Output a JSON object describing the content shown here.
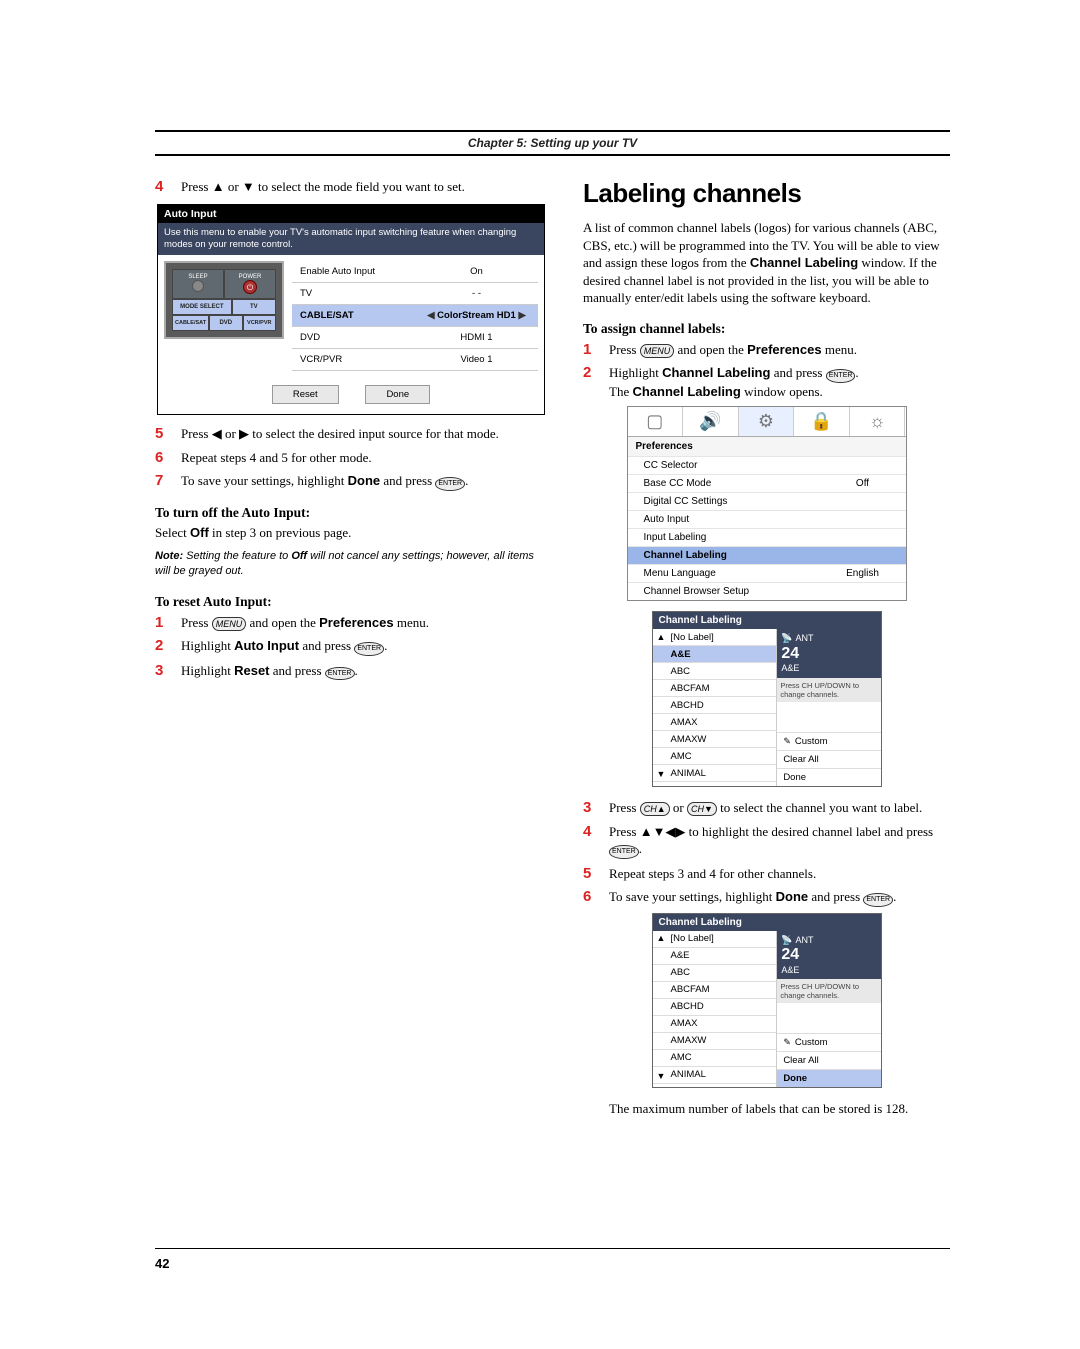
{
  "chapter_header": "Chapter 5: Setting up your TV",
  "page_number": "42",
  "left": {
    "step4": "Press ▲ or ▼ to select the mode field you want to set.",
    "auto_input": {
      "title": "Auto Input",
      "desc": "Use this menu to enable your TV's automatic input switching feature when changing modes on your remote control.",
      "remote": {
        "sleep": "SLEEP",
        "power": "POWER",
        "mode_select": "MODE SELECT",
        "tv": "TV",
        "cablesat": "CABLE/SAT",
        "dvd": "DVD",
        "vcrpvr": "VCR/PVR"
      },
      "table_header_left": "Enable Auto Input",
      "table_header_right": "On",
      "rows": [
        {
          "mode": "TV",
          "input": "- -"
        },
        {
          "mode": "CABLE/SAT",
          "input": "ColorStream HD1"
        },
        {
          "mode": "DVD",
          "input": "HDMI 1"
        },
        {
          "mode": "VCR/PVR",
          "input": "Video 1"
        }
      ],
      "reset": "Reset",
      "done": "Done"
    },
    "step5": "Press ◀ or ▶ to select the desired input source for that mode.",
    "step6": "Repeat steps 4 and 5 for other mode.",
    "step7_a": "To save your settings, highlight ",
    "step7_b": "Done",
    "step7_c": " and press ",
    "turn_off_head": "To turn off the Auto Input:",
    "turn_off_txt_a": "Select ",
    "turn_off_txt_b": "Off",
    "turn_off_txt_c": " in step 3 on previous page.",
    "note_a": "Note:",
    "note_b": " Setting the feature to ",
    "note_c": "Off",
    "note_d": " will not cancel any settings; however, all items will be grayed out.",
    "reset_head": "To reset Auto Input:",
    "reset1_a": "Press ",
    "reset1_b": " and open the ",
    "reset1_c": "Preferences",
    "reset1_d": " menu.",
    "reset2_a": "Highlight ",
    "reset2_b": "Auto Input",
    "reset2_c": " and press ",
    "reset3_a": "Highlight ",
    "reset3_b": "Reset",
    "reset3_c": " and press ",
    "menu_label": "MENU",
    "enter_label": "ENTER"
  },
  "right": {
    "title": "Labeling channels",
    "intro_a": "A list of common channel labels (logos) for various channels (ABC, CBS, etc.) will be programmed into the TV. You will be able to view and assign these logos from the ",
    "intro_b": "Channel Labeling",
    "intro_c": " window. If the desired channel label is not provided in the list, you will be able to manually enter/edit labels using the software keyboard.",
    "assign_head": "To assign channel labels:",
    "s1_a": "Press ",
    "s1_b": " and open the ",
    "s1_c": "Preferences",
    "s1_d": " menu.",
    "s2_a": "Highlight ",
    "s2_b": "Channel Labeling",
    "s2_c": " and press ",
    "s2_d": "The ",
    "s2_e": "Channel Labeling",
    "s2_f": " window opens.",
    "prefs": {
      "title": "Preferences",
      "rows": [
        {
          "name": "CC Selector",
          "val": ""
        },
        {
          "name": "Base CC Mode",
          "val": "Off"
        },
        {
          "name": "Digital CC Settings",
          "val": ""
        },
        {
          "name": "Auto Input",
          "val": ""
        },
        {
          "name": "Input Labeling",
          "val": ""
        },
        {
          "name": "Channel Labeling",
          "val": ""
        },
        {
          "name": "Menu Language",
          "val": "English"
        },
        {
          "name": "Channel Browser Setup",
          "val": ""
        }
      ]
    },
    "cl": {
      "title": "Channel Labeling",
      "items": [
        "[No Label]",
        "A&E",
        "ABC",
        "ABCFAM",
        "ABCHD",
        "AMAX",
        "AMAXW",
        "AMC",
        "ANIMAL"
      ],
      "preview_ant": "ANT",
      "preview_num": "24",
      "preview_label": "A&E",
      "hint": "Press CH UP/DOWN to change channels.",
      "custom": "Custom",
      "clear": "Clear All",
      "done": "Done"
    },
    "s3": "Press  or  to select the channel you want to label.",
    "s3_full_a": "Press ",
    "s3_full_b": " or ",
    "s3_full_c": " to select the channel you want to label.",
    "s4_a": "Press ▲▼◀▶ to highlight the desired channel label and press ",
    "s5": "Repeat steps 3 and 4 for other channels.",
    "s6_a": "To save your settings, highlight ",
    "s6_b": "Done",
    "s6_c": " and press ",
    "footer": "The maximum number of labels that can be stored is 128.",
    "ch_up": "CH▲",
    "ch_dn": "CH▼"
  }
}
